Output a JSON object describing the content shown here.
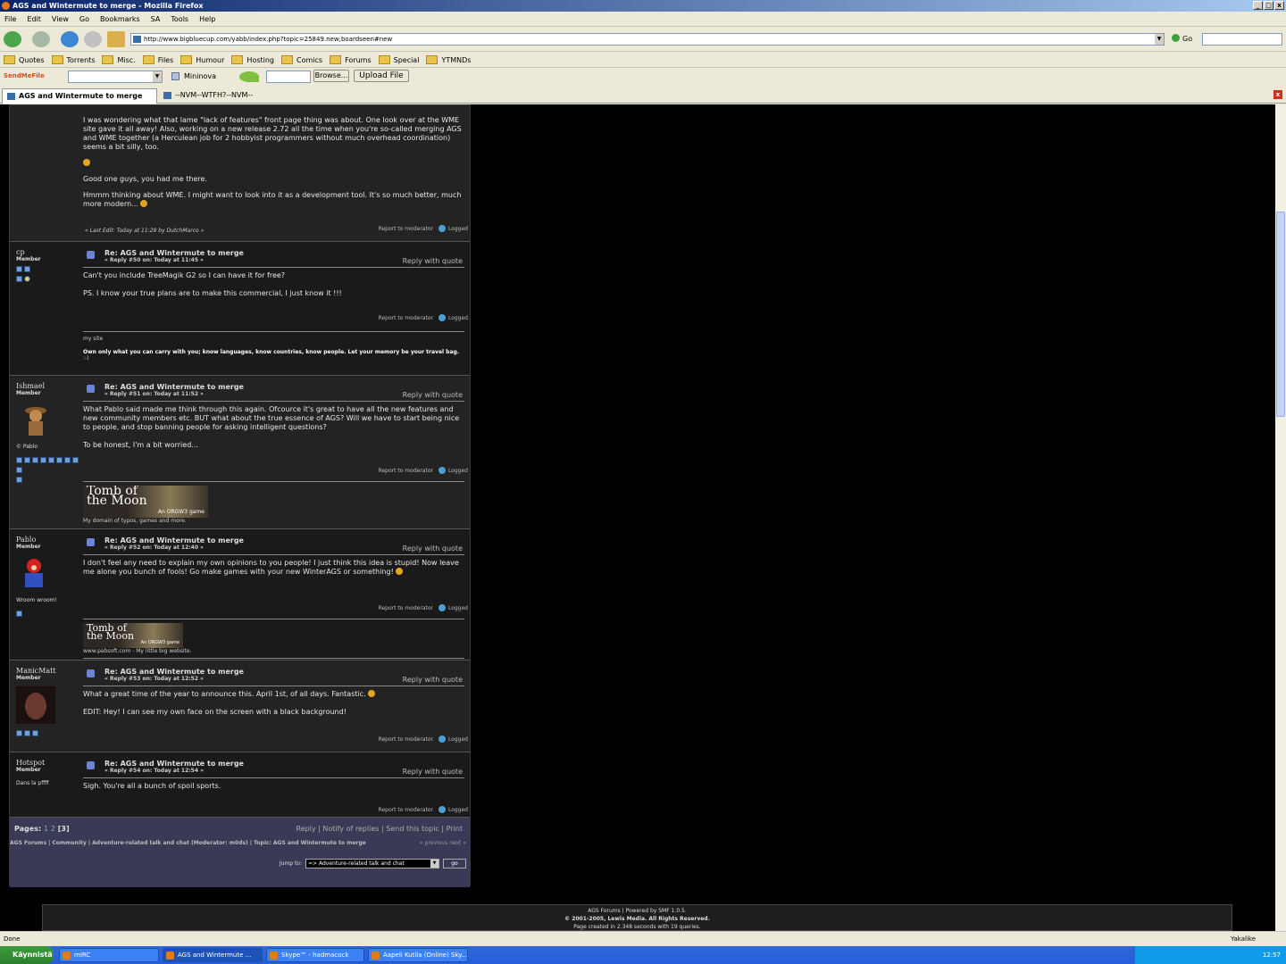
{
  "window": {
    "title": "AGS and Wintermute to merge - Mozilla Firefox"
  },
  "menu": [
    "File",
    "Edit",
    "View",
    "Go",
    "Bookmarks",
    "SA",
    "Tools",
    "Help"
  ],
  "nav": {
    "url": "http://www.bigbluecup.com/yabb/index.php?topic=25849.new;boardseen#new",
    "go_label": "Go"
  },
  "bookmarks": [
    "Quotes",
    "Torrents",
    "Misc.",
    "Files",
    "Humour",
    "Hosting",
    "Comics",
    "Forums",
    "Special",
    "YTMNDs"
  ],
  "toolbar2": {
    "sendmefile": "SendMeFile",
    "mininova": "Mininova",
    "browse": "Browse...",
    "upload": "Upload File"
  },
  "tabs": [
    {
      "label": "AGS and Wintermute to merge"
    },
    {
      "label": "--NVM--WTFH?--NVM--"
    }
  ],
  "post0": {
    "p1": "I was wondering what that lame \"lack of features\" front page thing was about. One look over at the WME site gave it all away! Also, working on a new release 2.72 all the time when you're so-called merging AGS and WME together (a Herculean job for 2 hobbyist programmers without much overhead coordination) seems a bit silly, too.",
    "p2": "Good one guys, you had me there.",
    "p3": "Hmmm thinking about WME. I might want to look into it as a development tool. It's so much better, much more modern...",
    "lastedit": "« Last Edit: Today at 11:29 by DutchMarco »",
    "report": "Report to moderator",
    "logged": "Logged"
  },
  "posts": [
    {
      "name": "cp",
      "rank": "Member",
      "text": "",
      "subject": "Re: AGS and Wintermute to merge",
      "meta": "« Reply #50 on: Today at 11:45 »",
      "quote": "Reply with quote",
      "lines": [
        "Can't you include  TreeMagik G2 so I can have it for free?",
        "PS. I know your true plans are to make this  commercial, I just know it   !!!"
      ],
      "sig1": "my site",
      "sig2": "Own only what you can carry with you; know languages, know countries, know people. Let your memory be your travel bag.",
      "sig3": ":-)",
      "report": "Report to moderator",
      "logged": "Logged"
    },
    {
      "name": "Ishmael",
      "rank": "Member",
      "text": "© Pablo",
      "subject": "Re: AGS and Wintermute to merge",
      "meta": "« Reply #51 on: Today at 11:52 »",
      "quote": "Reply with quote",
      "lines": [
        "What Pablo said made me think through this again. Ofcource it's great to have all the new features and new community members etc. BUT what about the true essence of AGS?  Will we have to start being nice to people, and stop banning people for asking intelligent questions?",
        "To be honest, I'm a bit worried..."
      ],
      "banner": "Tomb of the Moon",
      "banner_tag": "An ORGW3 game",
      "sig1": "My domain of typos, games and more.",
      "report": "Report to moderator",
      "logged": "Logged"
    },
    {
      "name": "Pablo",
      "rank": "Member",
      "text": "Wroom wroom!",
      "subject": "Re: AGS and Wintermute to merge",
      "meta": "« Reply #52 on: Today at 12:40 »",
      "quote": "Reply with quote",
      "lines": [
        "I don't feel any need to explain my own opinions to you people! I just think this idea is stupid! Now leave me alone you bunch of fools! Go make games with your new WinterAGS or something!"
      ],
      "banner": "Tomb of the Moon",
      "banner_tag": "An ORGW3 game",
      "sig1": "www.pabsoft.com - My little big website.",
      "report": "Report to moderator",
      "logged": "Logged"
    },
    {
      "name": "ManicMatt",
      "rank": "Member",
      "text": "",
      "subject": "Re: AGS and Wintermute to merge",
      "meta": "« Reply #53 on: Today at 12:52 »",
      "quote": "Reply with quote",
      "lines": [
        "What a great time of the year to announce this. April 1st, of all days. Fantastic.",
        "EDIT: Hey! I can see my own face on the screen with a black background!"
      ],
      "report": "Report to moderator",
      "logged": "Logged"
    },
    {
      "name": "Hotspot",
      "rank": "Member",
      "text": "Dans la pffff",
      "subject": "Re: AGS and Wintermute to merge",
      "meta": "« Reply #54 on: Today at 12:54 »",
      "quote": "Reply with quote",
      "lines": [
        "Sigh. You're all a bunch of spoil sports."
      ],
      "report": "Report to moderator",
      "logged": "Logged"
    }
  ],
  "bottom": {
    "pages_label": "Pages:",
    "page1": "1",
    "page2": "2",
    "page3": "[3]",
    "actions": "Reply  |  Notify of replies  |  Send this topic  |  Print",
    "linktree": "AGS Forums  |  Community  |  Adventure-related talk and chat (Moderator: m0ds)  |  Topic: AGS and Wintermute to merge",
    "prevnext": "« previous next »",
    "jump_label": "Jump to:",
    "jump_value": "=> Adventure-related talk and chat",
    "go": "go"
  },
  "footer": {
    "l1": "AGS Forums | Powered by SMF 1.0.5.",
    "l2": "© 2001-2005, Lewis Media. All Rights Reserved.",
    "l3": "Page created in 2.348 seconds with 19 queries."
  },
  "status": {
    "text": "Done",
    "yak": "Yakalike"
  },
  "taskbar": {
    "start": "Käynnistä",
    "items": [
      "mIRC",
      "AGS and Wintermute ...",
      "Skype™ - hadmacock",
      "Aapeli Kutila (Online) Sky..."
    ],
    "lang": "FI",
    "clock": "12:57"
  }
}
